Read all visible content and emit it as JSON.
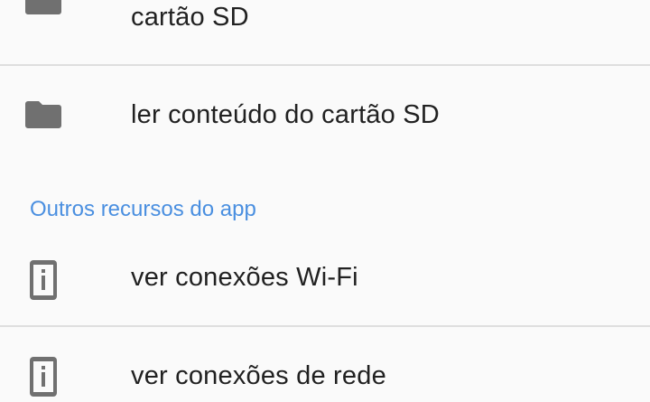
{
  "permissions": {
    "storage": {
      "items": [
        {
          "label": "cartão SD",
          "icon": "folder-icon"
        },
        {
          "label": "ler conteúdo do cartão SD",
          "icon": "folder-icon"
        }
      ]
    },
    "other": {
      "header": "Outros recursos do app",
      "items": [
        {
          "label": "ver conexões Wi-Fi",
          "icon": "info-phone-icon"
        },
        {
          "label": "ver conexões de rede",
          "icon": "info-phone-icon"
        }
      ]
    }
  },
  "colors": {
    "accent": "#4a8fe0",
    "icon": "#707070",
    "text": "#212121",
    "divider": "#dedede",
    "background": "#fafafa"
  }
}
